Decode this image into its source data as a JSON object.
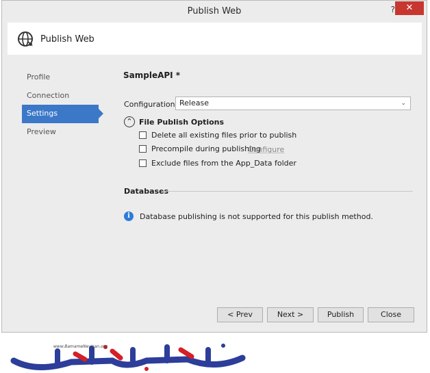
{
  "window": {
    "title": "Publish Web",
    "help_label": "?",
    "close_label": "✕"
  },
  "header": {
    "title": "Publish Web"
  },
  "nav": {
    "items": [
      {
        "label": "Profile"
      },
      {
        "label": "Connection"
      },
      {
        "label": "Settings"
      },
      {
        "label": "Preview"
      }
    ],
    "selected": "Settings"
  },
  "main": {
    "profile_name": "SampleAPI *",
    "configuration_label": "Configuration:",
    "configuration_value": "Release",
    "file_publish": {
      "title": "File Publish Options",
      "toggle": "⌃",
      "options": [
        {
          "label": "Delete all existing files prior to publish",
          "checked": false
        },
        {
          "label": "Precompile during publishing",
          "checked": false
        },
        {
          "label": "Exclude files from the App_Data folder",
          "checked": false
        }
      ],
      "configure_link": "Configure"
    },
    "databases": {
      "title": "Databases",
      "info": "Database publishing is not supported for this publish method."
    }
  },
  "buttons": {
    "prev": "< Prev",
    "next": "Next >",
    "publish": "Publish",
    "close": "Close"
  },
  "watermark": {
    "url": "www.BamameNevisan.org",
    "logo_text": "برنامه نویسان"
  },
  "colors": {
    "accent": "#3b78c8",
    "close_button": "#c7372f",
    "info": "#2e7cd6",
    "logo_blue": "#2c3e9a",
    "logo_red": "#d42026"
  }
}
